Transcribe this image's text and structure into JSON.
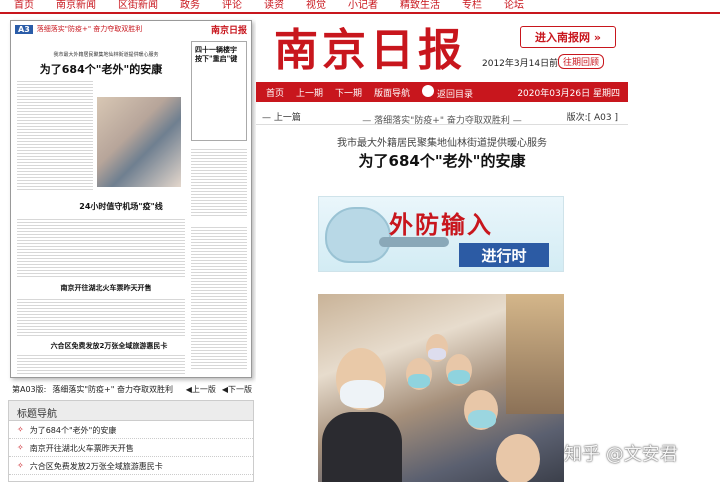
{
  "topnav": [
    "首页",
    "南京新闻",
    "区街新闻",
    "政务",
    "评论",
    "读资",
    "视觉",
    "小记者",
    "精致生活",
    "专栏",
    "论坛"
  ],
  "thumb": {
    "badge": "A3",
    "header": "落细落实\"防疫+\" 奋力夺取双胜利",
    "logo": "南京日报",
    "subtitle": "我市最大外籍居民聚集地仙林街道提供暖心服务",
    "title1": "为了684个\"老外\"的安康",
    "side": "四十一辆楼宇按下\"重启\"键",
    "h2": "24小时值守机场\"疫\"线",
    "h3": "南京开往湖北火车票昨天开售",
    "h4": "六合区免费发放2万张全域旅游惠民卡"
  },
  "pageline": {
    "label": "第A03版:",
    "title": "落细落实\"防疫+\" 奋力夺取双胜利",
    "prev": "上一版",
    "next": "下一版"
  },
  "nav": {
    "heading": "标题导航",
    "items": [
      "为了684个\"老外\"的安康",
      "南京开往湖北火车票昨天开售",
      "六合区免费发放2万张全域旅游惠民卡"
    ]
  },
  "mast": {
    "logo": "南京日报",
    "enter": "进入南报网 »",
    "date": "2012年3月14日前",
    "review": "往期回顾"
  },
  "redbar": {
    "items": [
      "首页",
      "上一期",
      "下一期",
      "版面导航",
      "返回目录"
    ],
    "date": "2020年03月26日 星期四"
  },
  "article": {
    "up": "— 上一篇",
    "edition": "版次:[ A03 ]",
    "kicker": "— 落细落实\"防疫+\" 奋力夺取双胜利 —",
    "pre": "我市最大外籍居民聚集地仙林街道提供暖心服务",
    "title": "为了684个\"老外\"的安康",
    "banner1": "外防输入",
    "banner2": "进行时"
  },
  "watermark": "知乎 @文安君",
  "colors": {
    "red": "#c8161d",
    "blue": "#2c5ba4"
  }
}
